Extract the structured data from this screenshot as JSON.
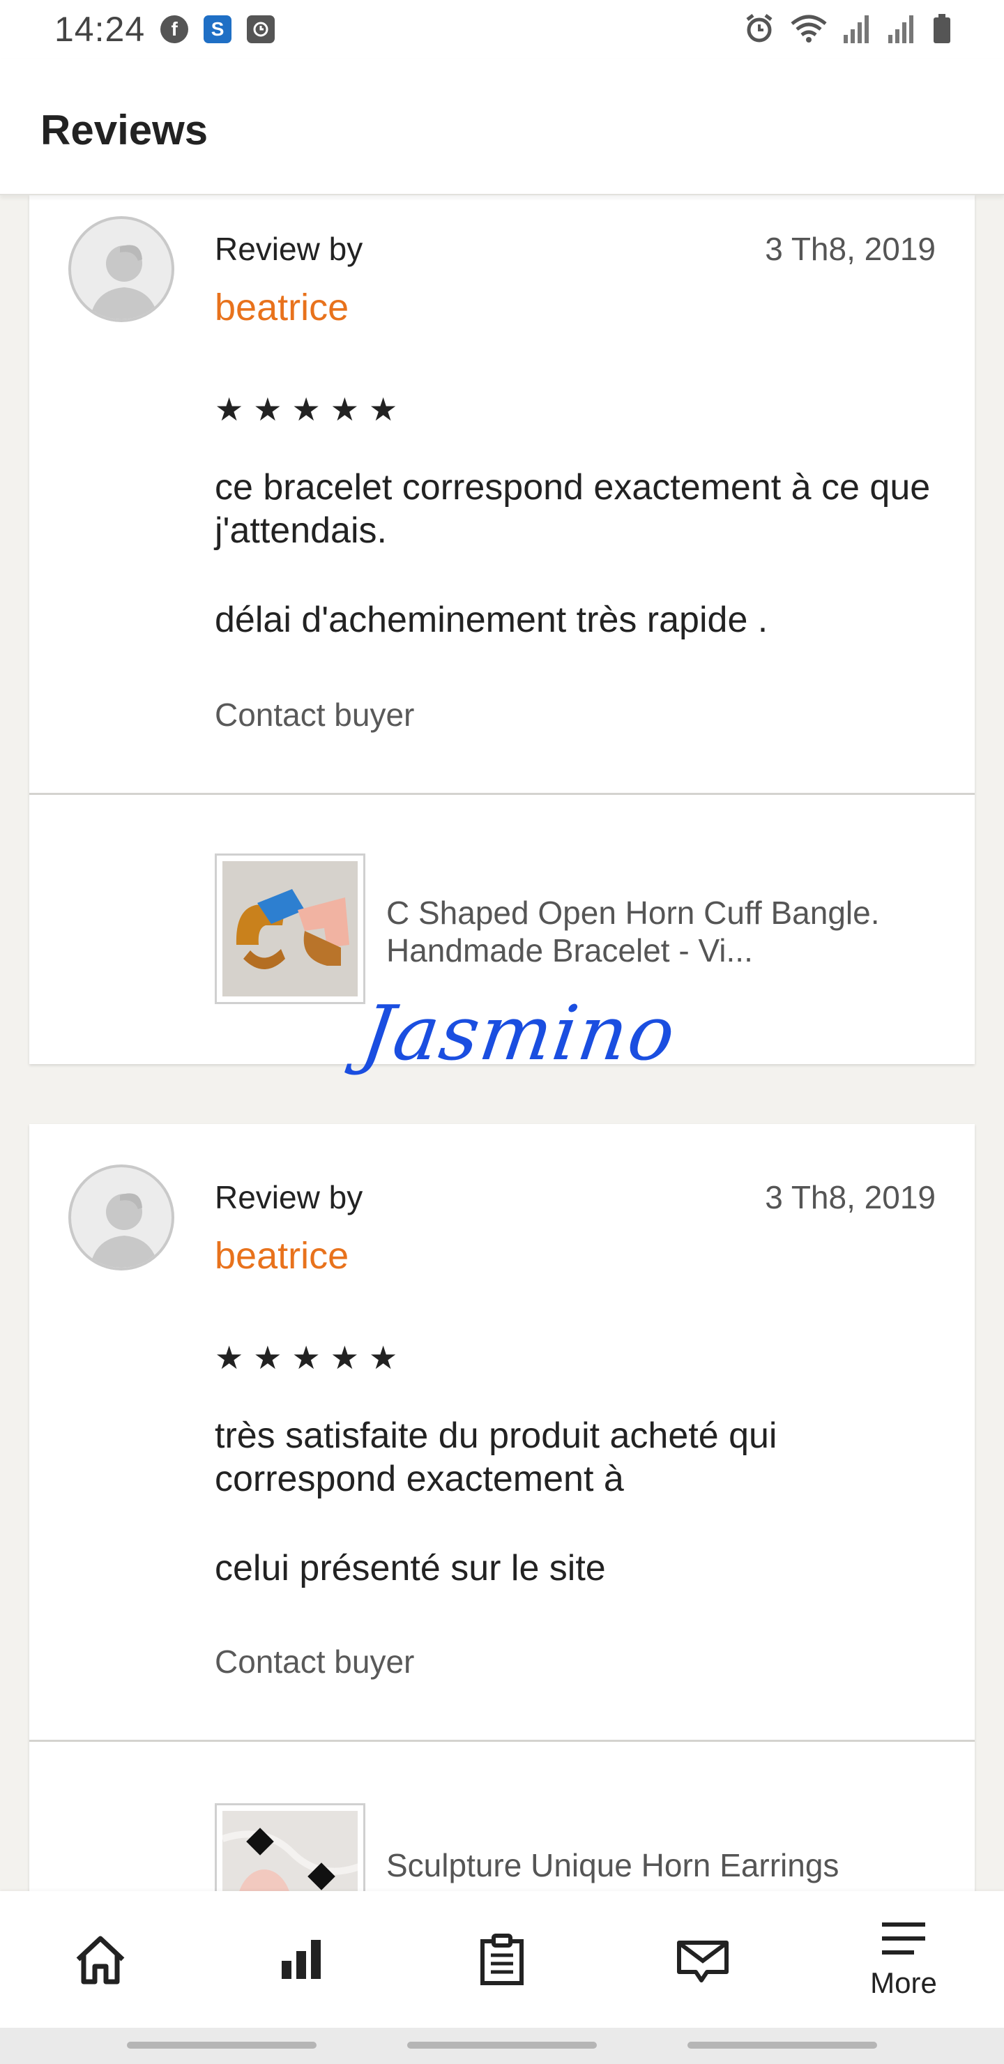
{
  "status_bar": {
    "time": "14:24",
    "left_icons": [
      "facebook-icon",
      "s-app-icon",
      "clock-app-icon"
    ],
    "right_icons": [
      "alarm-icon",
      "wifi-icon",
      "signal-icon",
      "signal-icon",
      "battery-icon"
    ]
  },
  "header": {
    "title": "Reviews"
  },
  "reviews": [
    {
      "review_by": "Review by",
      "reviewer": "beatrice",
      "date": "3 Th8, 2019",
      "stars": [
        "★",
        "★",
        "★",
        "★",
        "★"
      ],
      "text_line1": "ce bracelet correspond exactement à ce que j'attendais.",
      "text_line2": "délai d'acheminement très rapide .",
      "contact": "Contact buyer",
      "product_title": "C Shaped Open Horn Cuff Bangle. Handmade Bracelet - Vi..."
    },
    {
      "review_by": "Review by",
      "reviewer": "beatrice",
      "date": "3 Th8, 2019",
      "stars": [
        "★",
        "★",
        "★",
        "★",
        "★"
      ],
      "text_line1": "très satisfaite du produit acheté qui correspond exactement  à",
      "text_line2": "celui présenté sur le site",
      "contact": "Contact buyer",
      "product_title": "Sculpture Unique Horn Earrings"
    }
  ],
  "signature": "Jasmino",
  "colors": {
    "accent": "#e8721c",
    "signature": "#1a4ee0"
  },
  "bottom_nav": {
    "items": [
      {
        "icon": "home-icon",
        "label": ""
      },
      {
        "icon": "stats-icon",
        "label": ""
      },
      {
        "icon": "orders-icon",
        "label": ""
      },
      {
        "icon": "messages-icon",
        "label": ""
      },
      {
        "icon": "menu-icon",
        "label": "More"
      }
    ]
  }
}
